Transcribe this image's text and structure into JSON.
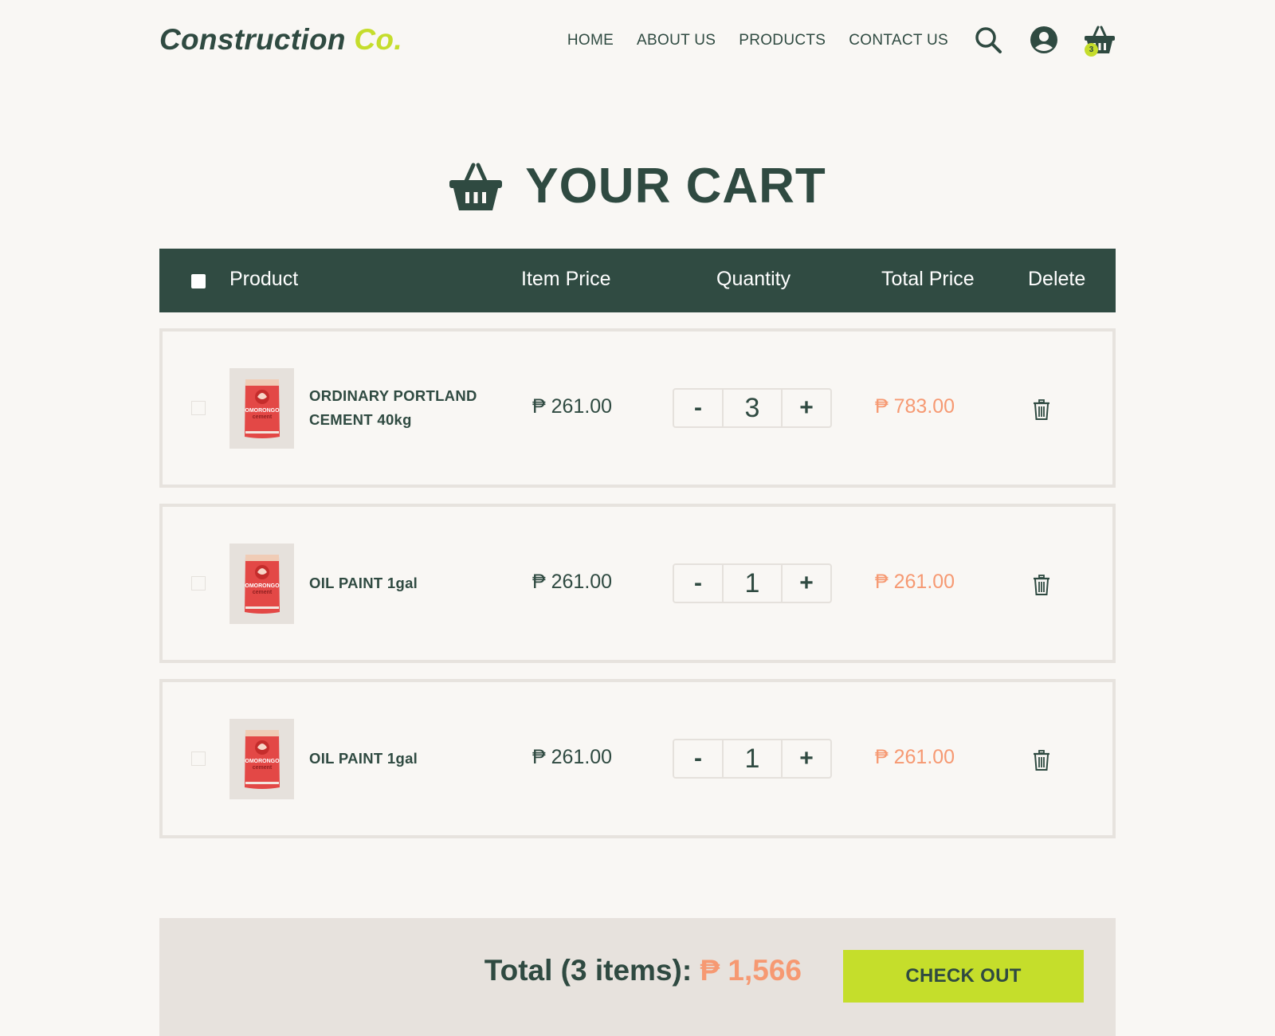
{
  "brand": {
    "name": "Construction",
    "suffix": "Co."
  },
  "nav": [
    "HOME",
    "ABOUT US",
    "PRODUCTS",
    "CONTACT US"
  ],
  "header_icons": {
    "search": "search-icon",
    "account": "user-circle-icon",
    "cart": "basket-icon",
    "cart_count": "3"
  },
  "page": {
    "title": "YOUR CART",
    "title_icon": "basket-icon"
  },
  "table": {
    "columns": [
      "Product",
      "Item Price",
      "Quantity",
      "Total Price",
      "Delete"
    ],
    "rows": [
      {
        "name_line1": "ORDINARY PORTLAND",
        "name_line2": "CEMENT 40kg",
        "item_price": "₱ 261.00",
        "quantity": "3",
        "total_price": "₱ 783.00",
        "decrement": "-",
        "increment": "+",
        "thumb_brand": "OMORONGO",
        "thumb_sub": "cement"
      },
      {
        "name_line1": "OIL PAINT 1gal",
        "name_line2": "",
        "item_price": "₱ 261.00",
        "quantity": "1",
        "total_price": "₱ 261.00",
        "decrement": "-",
        "increment": "+",
        "thumb_brand": "OMORONGO",
        "thumb_sub": "cement"
      },
      {
        "name_line1": "OIL PAINT 1gal",
        "name_line2": "",
        "item_price": "₱ 261.00",
        "quantity": "1",
        "total_price": "₱ 261.00",
        "decrement": "-",
        "increment": "+",
        "thumb_brand": "OMORONGO",
        "thumb_sub": "cement"
      }
    ]
  },
  "summary": {
    "label": "Total (3 items):",
    "amount": "₱ 1,566",
    "checkout_label": "CHECK OUT"
  },
  "colors": {
    "primary": "#304b42",
    "accent": "#c5de2b",
    "price": "#f69972",
    "background": "#f9f7f4",
    "footer_bg": "#e7e2dd",
    "border": "#e7e3de"
  }
}
